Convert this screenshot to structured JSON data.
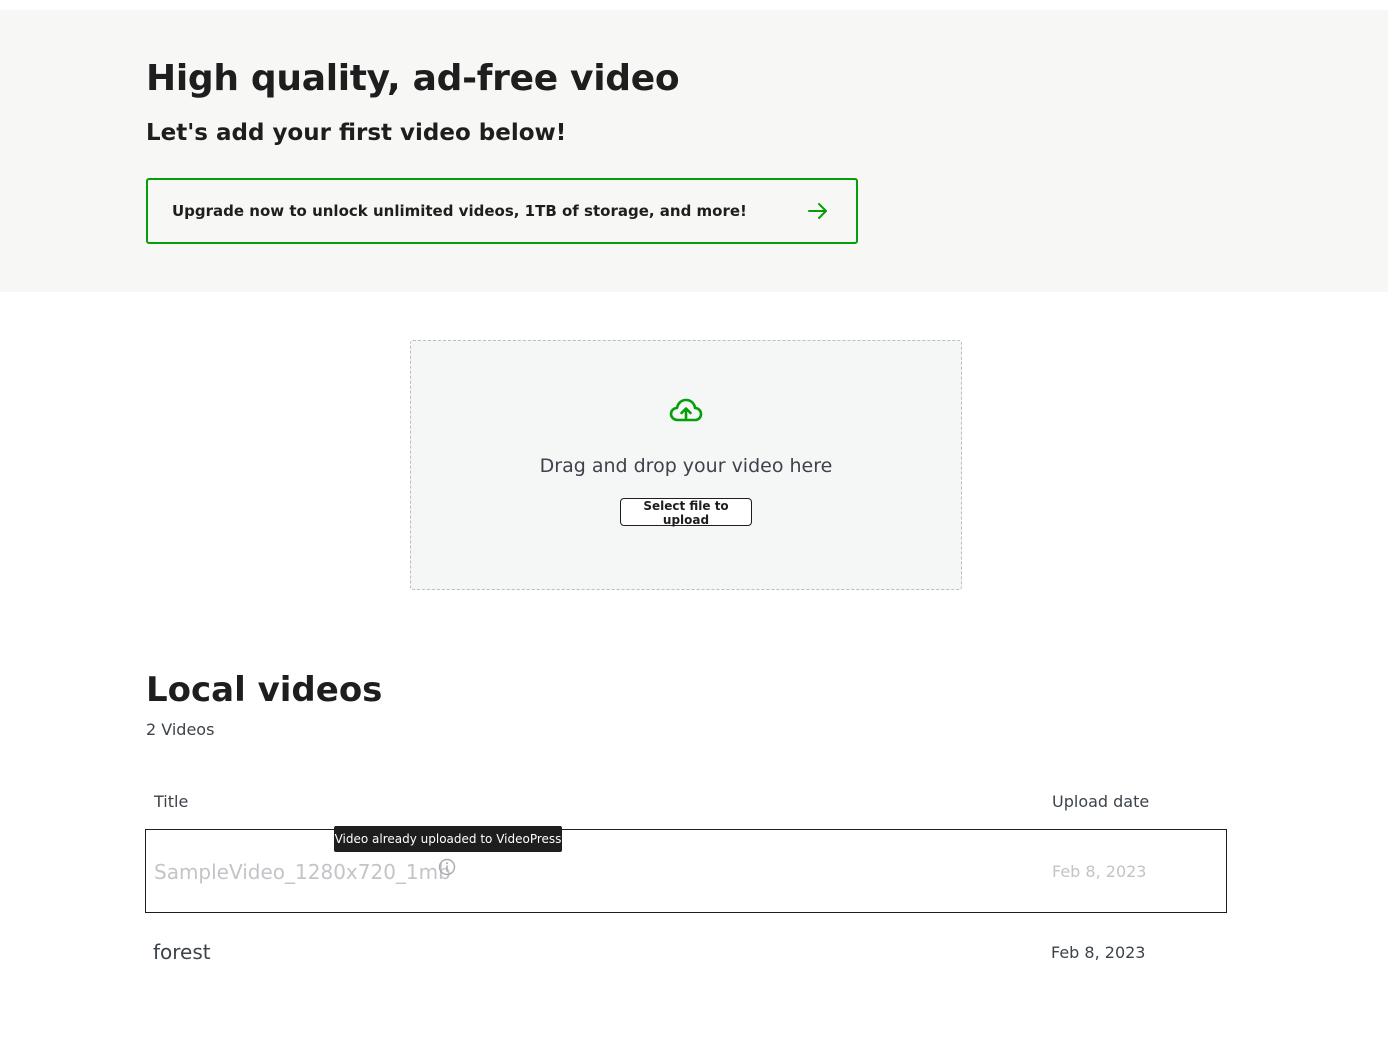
{
  "hero": {
    "title": "High quality, ad-free video",
    "subtitle": "Let's add your first video below!",
    "upgrade_text": "Upgrade now to unlock unlimited videos, 1TB of storage, and more!",
    "accent_color": "#069e08"
  },
  "upload": {
    "drop_text": "Drag and drop your video here",
    "select_button_label": "Select file to upload"
  },
  "local_videos": {
    "title": "Local videos",
    "count_text": "2 Videos",
    "columns": {
      "title": "Title",
      "upload_date": "Upload date"
    },
    "rows": [
      {
        "title": "SampleVideo_1280x720_1mb",
        "date": "Feb 8, 2023",
        "tooltip": "Video already uploaded to VideoPress",
        "disabled": true,
        "icon": "info-icon"
      },
      {
        "title": "forest",
        "date": "Feb 8, 2023",
        "disabled": false
      }
    ]
  }
}
